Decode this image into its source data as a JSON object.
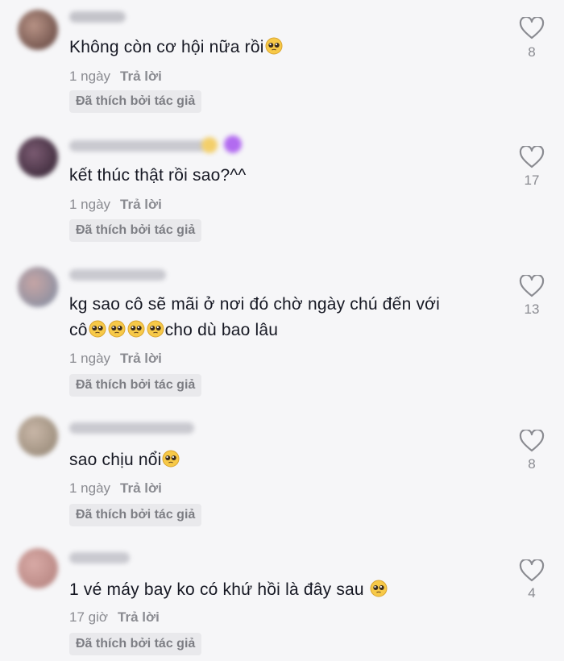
{
  "comments": [
    {
      "text": "Không còn cơ hội nữa rồi",
      "emoji_count": 1,
      "time": "1 ngày",
      "reply_label": "Trả lời",
      "liked_label": "Đã thích bởi tác giả",
      "likes": "8"
    },
    {
      "text": "kết thúc thật rồi sao?^^",
      "emoji_count": 0,
      "time": "1 ngày",
      "reply_label": "Trả lời",
      "liked_label": "Đã thích bởi tác giả",
      "likes": "17"
    },
    {
      "text_line1": "kg sao cô sẽ mãi ở nơi đó chờ ngày chú đến với",
      "text_line2_prefix": "cô",
      "text_line2_suffix": "cho dù bao lâu",
      "emoji_count": 4,
      "time": "1 ngày",
      "reply_label": "Trả lời",
      "liked_label": "Đã thích bởi tác giả",
      "likes": "13"
    },
    {
      "text": "sao chịu nổi",
      "emoji_count": 1,
      "time": "1 ngày",
      "reply_label": "Trả lời",
      "liked_label": "Đã thích bởi tác giả",
      "likes": "8"
    },
    {
      "text": "1 vé máy bay ko có khứ hồi là đây sau ",
      "emoji_count": 1,
      "time": "17 giờ",
      "reply_label": "Trả lời",
      "liked_label": "Đã thích bởi tác giả",
      "likes": "4"
    }
  ],
  "icons": {
    "heart": "heart-icon",
    "emoji": "pleading-face-emoji"
  },
  "colors": {
    "background": "#f6f6f8",
    "text": "#161823",
    "muted": "#8a8b91",
    "badge_bg": "#e9e9ec"
  }
}
